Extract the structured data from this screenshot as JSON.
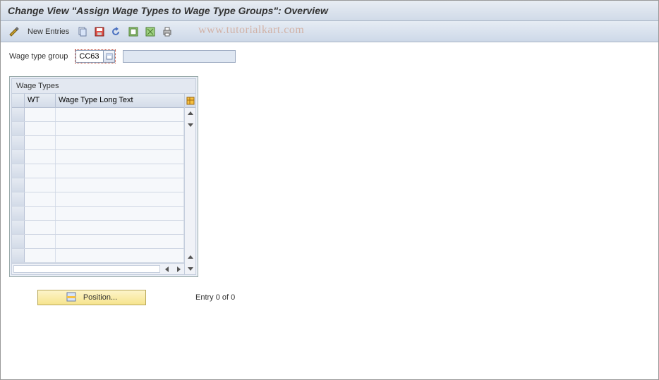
{
  "title": "Change View \"Assign Wage Types to Wage Type Groups\": Overview",
  "toolbar": {
    "new_entries": "New Entries"
  },
  "watermark": "www.tutorialkart.com",
  "form": {
    "label": "Wage type group",
    "value": "CC63",
    "description": ""
  },
  "table": {
    "title": "Wage Types",
    "columns": {
      "wt": "WT",
      "text": "Wage Type Long Text"
    },
    "rows": [
      {
        "wt": "",
        "text": ""
      },
      {
        "wt": "",
        "text": ""
      },
      {
        "wt": "",
        "text": ""
      },
      {
        "wt": "",
        "text": ""
      },
      {
        "wt": "",
        "text": ""
      },
      {
        "wt": "",
        "text": ""
      },
      {
        "wt": "",
        "text": ""
      },
      {
        "wt": "",
        "text": ""
      },
      {
        "wt": "",
        "text": ""
      },
      {
        "wt": "",
        "text": ""
      },
      {
        "wt": "",
        "text": ""
      }
    ]
  },
  "footer": {
    "position_label": "Position...",
    "entry_text": "Entry 0 of 0"
  }
}
